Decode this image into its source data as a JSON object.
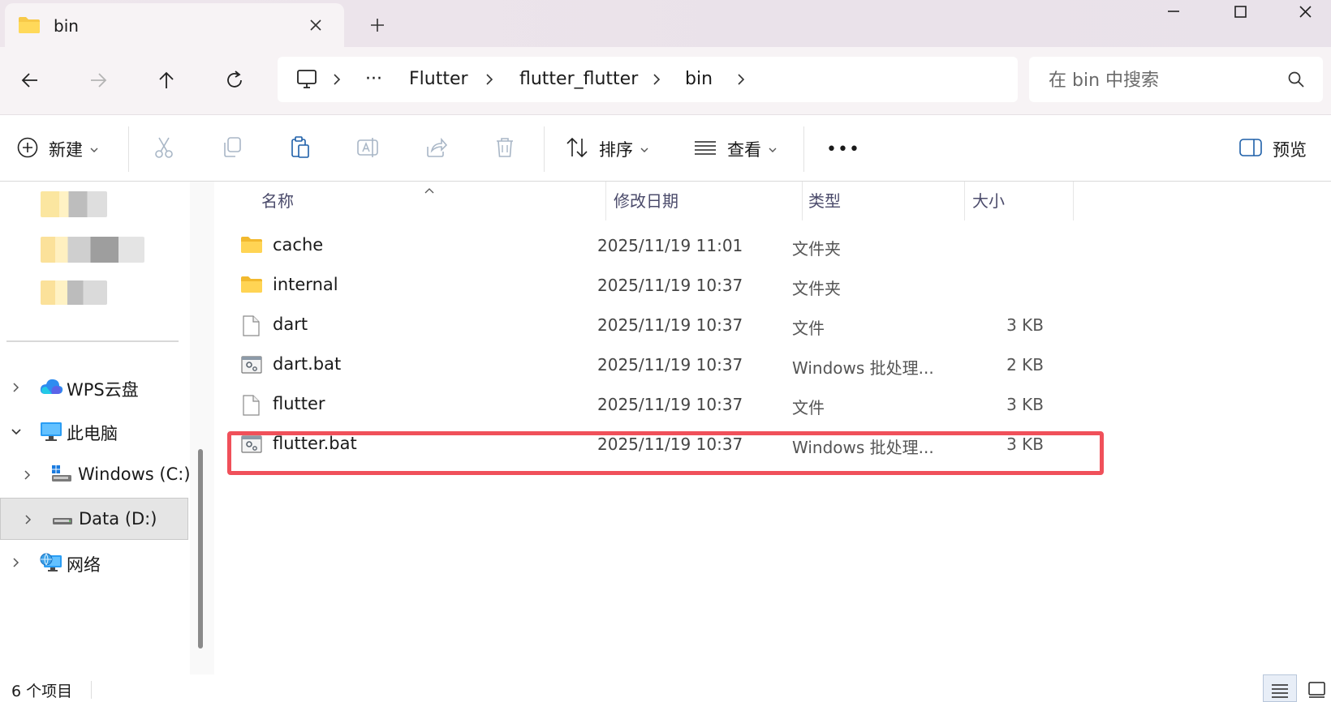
{
  "tab": {
    "title": "bin",
    "icon": "folder-icon",
    "close": "close-icon",
    "new_tab": "plus-icon"
  },
  "window_controls": [
    "minimize-icon",
    "maximize-icon",
    "close-icon"
  ],
  "navigation": {
    "back": "arrow-left-icon",
    "forward": "arrow-right-icon",
    "up": "arrow-up-icon",
    "refresh": "refresh-icon"
  },
  "address": {
    "root_icon": "computer-icon",
    "ellipsis": "···",
    "crumbs": [
      "Flutter",
      "flutter_flutter",
      "bin"
    ]
  },
  "search": {
    "placeholder": "在 bin 中搜索",
    "icon": "search-icon"
  },
  "toolbar": {
    "new_label": "新建",
    "sort_label": "排序",
    "view_label": "查看",
    "more_label": "•••",
    "preview_label": "预览",
    "icons": [
      "cut-icon",
      "copy-icon",
      "paste-icon",
      "rename-icon",
      "share-icon",
      "delete-icon"
    ]
  },
  "sidebar": {
    "items": [
      {
        "label": "WPS云盘",
        "icon": "cloud-icon",
        "chevron": "right"
      },
      {
        "label": "此电脑",
        "icon": "monitor-icon",
        "chevron": "down"
      },
      {
        "label": "Windows (C:)",
        "icon": "drive-c-icon",
        "chevron": "right"
      },
      {
        "label": "Data (D:)",
        "icon": "drive-icon",
        "chevron": "right",
        "selected": true
      },
      {
        "label": "网络",
        "icon": "network-icon",
        "chevron": "right"
      }
    ]
  },
  "columns": {
    "name": "名称",
    "date": "修改日期",
    "type": "类型",
    "size": "大小"
  },
  "files": [
    {
      "name": "cache",
      "date": "2025/11/19 11:01",
      "type": "文件夹",
      "size": "",
      "icon": "folder-icon"
    },
    {
      "name": "internal",
      "date": "2025/11/19 10:37",
      "type": "文件夹",
      "size": "",
      "icon": "folder-icon"
    },
    {
      "name": "dart",
      "date": "2025/11/19 10:37",
      "type": "文件",
      "size": "3 KB",
      "icon": "file-icon"
    },
    {
      "name": "dart.bat",
      "date": "2025/11/19 10:37",
      "type": "Windows 批处理...",
      "size": "2 KB",
      "icon": "batch-file-icon"
    },
    {
      "name": "flutter",
      "date": "2025/11/19 10:37",
      "type": "文件",
      "size": "3 KB",
      "icon": "file-icon"
    },
    {
      "name": "flutter.bat",
      "date": "2025/11/19 10:37",
      "type": "Windows 批处理...",
      "size": "3 KB",
      "icon": "batch-file-icon",
      "highlighted": true
    }
  ],
  "status": {
    "count": "6 个项目"
  },
  "colors": {
    "highlight": "#f0505a",
    "folder": "#f7c948",
    "accent": "#0067c0"
  }
}
